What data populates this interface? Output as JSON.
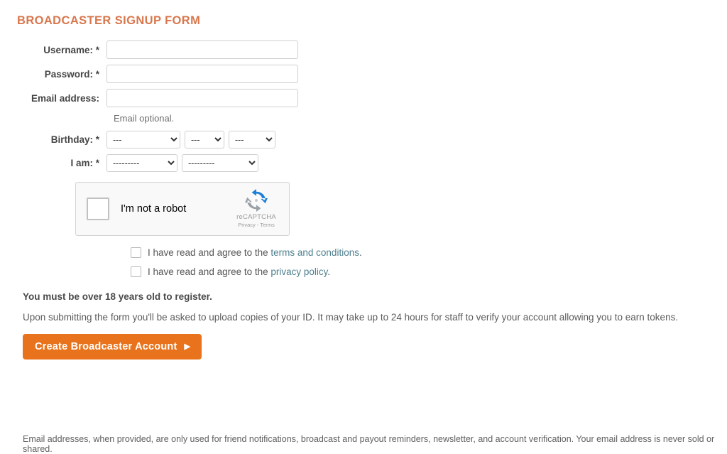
{
  "page": {
    "title": "Broadcaster Signup Form"
  },
  "form": {
    "fields": {
      "username": {
        "label": "Username: *",
        "value": "",
        "placeholder": ""
      },
      "password": {
        "label": "Password: *",
        "value": "",
        "placeholder": ""
      },
      "email": {
        "label": "Email address:",
        "value": "",
        "placeholder": "",
        "helper": "Email optional."
      },
      "birthday": {
        "label": "Birthday: *",
        "year": "---",
        "month": "---",
        "day": "---"
      },
      "i_am": {
        "label": "I am: *",
        "first": "---------",
        "second": "---------"
      }
    }
  },
  "recaptcha": {
    "label": "I'm not a robot",
    "brand": "reCAPTCHA",
    "privacy": "Privacy",
    "separator": "-",
    "terms": "Terms"
  },
  "agreements": [
    {
      "text_before": "I have read and agree to the ",
      "link_text": "terms and conditions",
      "text_after": "."
    },
    {
      "text_before": "I have read and agree to the ",
      "link_text": "privacy policy",
      "text_after": "."
    }
  ],
  "notices": {
    "age_requirement": "You must be over 18 years old to register.",
    "verification": "Upon submitting the form you'll be asked to upload copies of your ID. It may take up to 24 hours for staff to verify your account allowing you to earn tokens."
  },
  "submit": {
    "label": "Create Broadcaster Account",
    "arrow": "▶"
  },
  "footer": {
    "note": "Email addresses, when provided, are only used for friend notifications, broadcast and payout reminders, newsletter, and account verification. Your email address is never sold or shared."
  },
  "colors": {
    "title_orange": "#d9774d",
    "button_orange": "#e8731c",
    "link_teal": "#4d7f8e",
    "label_gray": "#454545",
    "body_gray": "#5b5b5b",
    "input_border": "#cfcfcf",
    "recaptcha_bg": "#f9f9f9",
    "recaptcha_blue": "#1c7fd6",
    "recaptcha_gray": "#9aa0a6"
  }
}
